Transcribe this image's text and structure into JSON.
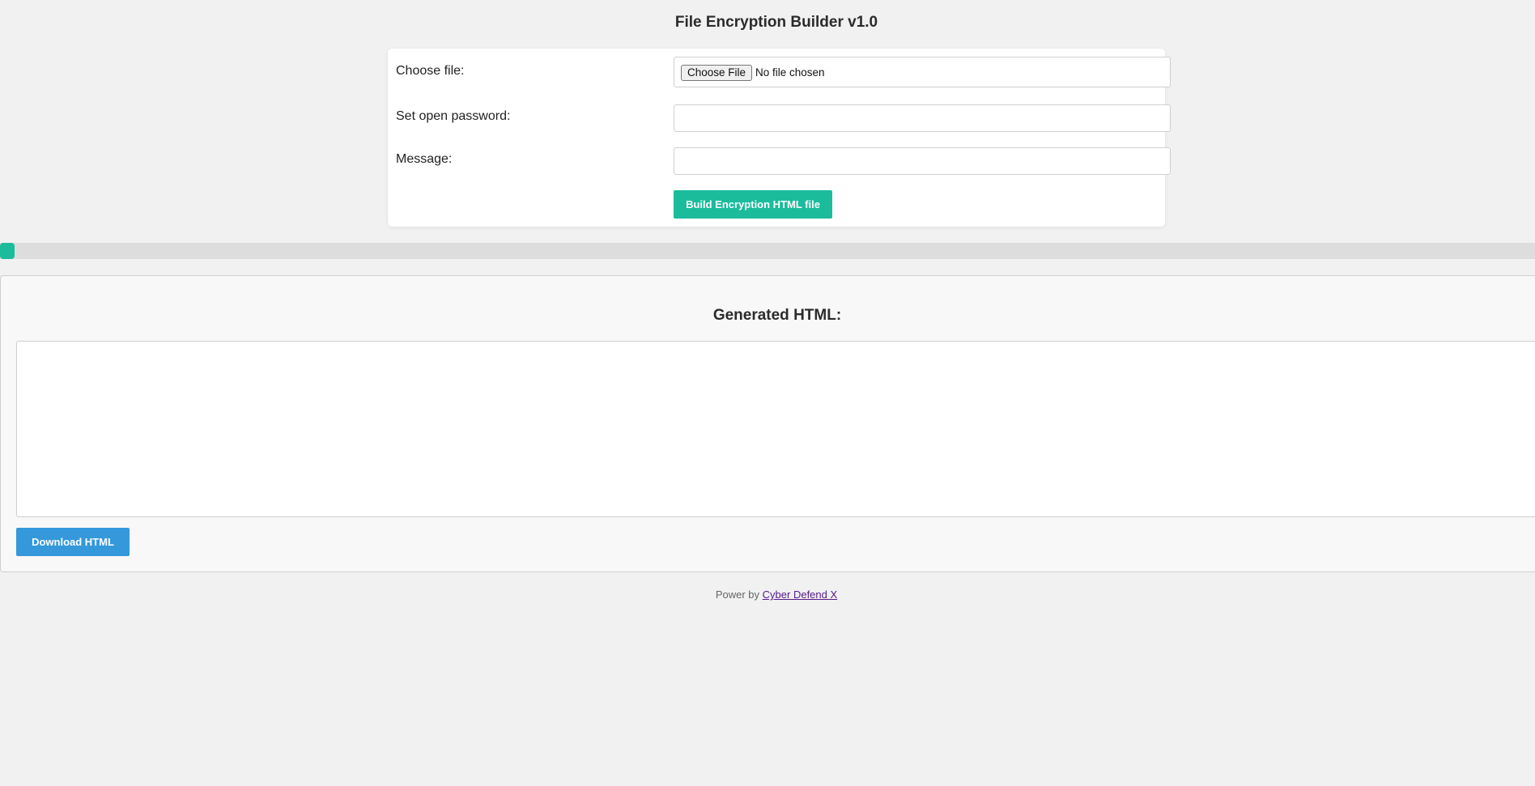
{
  "header": {
    "title": "File Encryption Builder v1.0"
  },
  "form": {
    "file_label": "Choose file:",
    "file_button": "Choose File",
    "file_status": "No file chosen",
    "password_label": "Set open password:",
    "password_value": "",
    "message_label": "Message:",
    "message_value": "",
    "build_button": "Build Encryption HTML file"
  },
  "progress": {
    "fraction": 0.009,
    "fill_color": "#1abc9c"
  },
  "output": {
    "title": "Generated HTML:",
    "content": "",
    "download_button": "Download HTML"
  },
  "footer": {
    "prefix": "Power by",
    "link_text": "Cyber Defend X"
  },
  "colors": {
    "build_button": "#1abc9c",
    "download_button": "#3498db",
    "link": "#551a8b"
  }
}
